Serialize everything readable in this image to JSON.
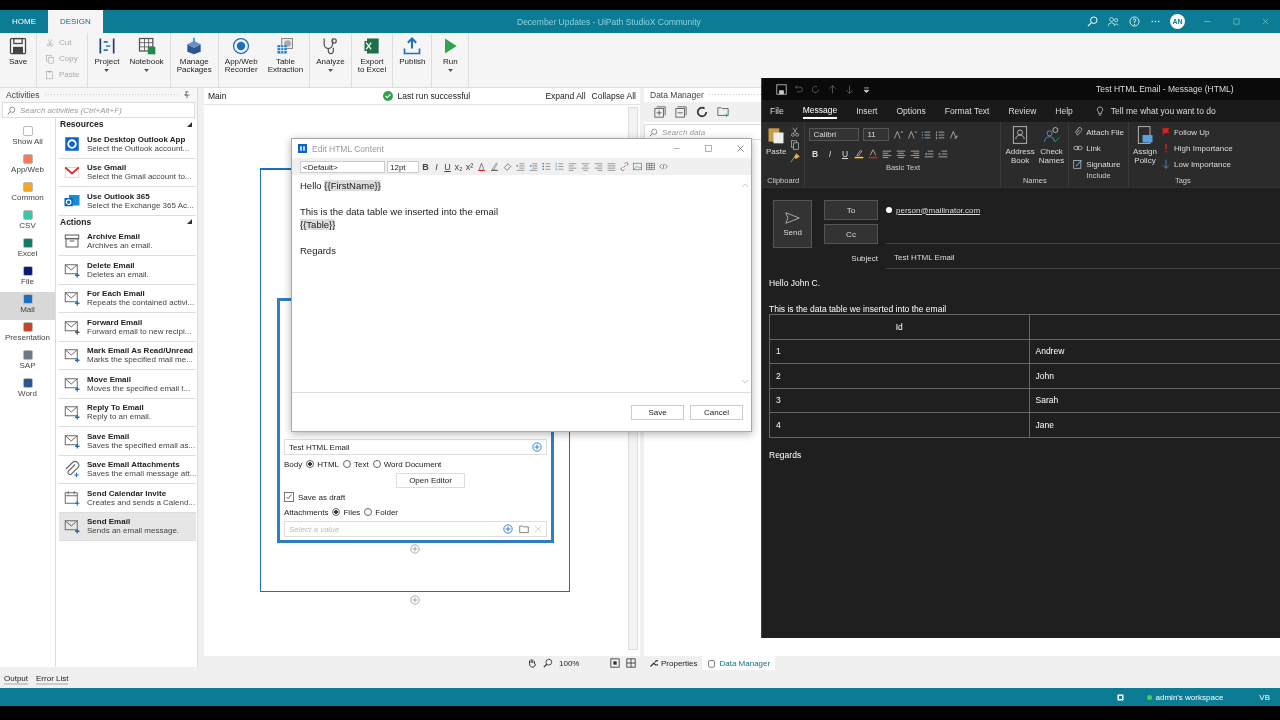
{
  "app": {
    "title": "December Updates - UiPath StudioX Community",
    "user_initials": "AN",
    "tabs": [
      {
        "label": "HOME",
        "selected": false
      },
      {
        "label": "DESIGN",
        "selected": true
      }
    ]
  },
  "ribbon_groups": [
    [
      {
        "kind": "large",
        "label": "Save",
        "menu": false
      }
    ],
    [
      {
        "kind": "small",
        "label": "Cut",
        "disabled": true
      },
      {
        "kind": "small",
        "label": "Copy",
        "disabled": true
      },
      {
        "kind": "small",
        "label": "Paste",
        "disabled": true
      }
    ],
    [
      {
        "kind": "large",
        "label": "Project",
        "menu": true
      },
      {
        "kind": "large",
        "label": "Notebook",
        "menu": true
      }
    ],
    [
      {
        "kind": "large",
        "label": "Manage\nPackages",
        "menu": false
      }
    ],
    [
      {
        "kind": "large",
        "label": "App/Web\nRecorder",
        "menu": false
      },
      {
        "kind": "large",
        "label": "Table\nExtraction",
        "menu": false
      }
    ],
    [
      {
        "kind": "large",
        "label": "Analyze",
        "menu": true
      }
    ],
    [
      {
        "kind": "large",
        "label": "Export\nto Excel",
        "menu": false
      }
    ],
    [
      {
        "kind": "large",
        "label": "Publish",
        "menu": false
      }
    ],
    [
      {
        "kind": "large",
        "label": "Run",
        "menu": true
      }
    ]
  ],
  "activities": {
    "title": "Activities",
    "search_placeholder": "Search activities (Ctrl+Alt+F)",
    "categories": [
      {
        "label": "Show All",
        "color": "#ffffff",
        "selected": false
      },
      {
        "label": "App/Web",
        "color": "#f47c5a",
        "selected": false
      },
      {
        "label": "Common",
        "color": "#f5a623",
        "selected": false
      },
      {
        "label": "CSV",
        "color": "#3cc6a4",
        "selected": false
      },
      {
        "label": "Excel",
        "color": "#127a66",
        "selected": false
      },
      {
        "label": "File",
        "color": "#0b1a7a",
        "selected": false
      },
      {
        "label": "Mail",
        "color": "#1a6fc2",
        "selected": true
      },
      {
        "label": "Presentation",
        "color": "#c4432a",
        "selected": false
      },
      {
        "label": "SAP",
        "color": "#707880",
        "selected": false
      },
      {
        "label": "Word",
        "color": "#2a5597",
        "selected": false
      }
    ],
    "sections": [
      {
        "title": "Resources",
        "items": [
          {
            "title": "Use Desktop Outlook App",
            "desc": "Select the Outlook account...",
            "selected": false
          },
          {
            "title": "Use Gmail",
            "desc": "Select the Gmail account to...",
            "selected": false
          },
          {
            "title": "Use Outlook 365",
            "desc": "Select the Exchange 365 Ac...",
            "selected": false
          }
        ]
      },
      {
        "title": "Actions",
        "items": [
          {
            "title": "Archive Email",
            "desc": "Archives an email.",
            "selected": false
          },
          {
            "title": "Delete Email",
            "desc": "Deletes an email.",
            "selected": false
          },
          {
            "title": "For Each Email",
            "desc": "Repeats the contained activi...",
            "selected": false
          },
          {
            "title": "Forward Email",
            "desc": "Forward email to new recipi...",
            "selected": false
          },
          {
            "title": "Mark Email As Read/Unread",
            "desc": "Marks the specified mail me...",
            "selected": false
          },
          {
            "title": "Move Email",
            "desc": "Moves the specified email t...",
            "selected": false
          },
          {
            "title": "Reply To Email",
            "desc": "Reply to an email.",
            "selected": false
          },
          {
            "title": "Save Email",
            "desc": "Saves the specified email as...",
            "selected": false
          },
          {
            "title": "Save Email Attachments",
            "desc": "Saves the email message att...",
            "selected": false
          },
          {
            "title": "Send Calendar Invite",
            "desc": "Creates and sends a Calend...",
            "selected": false
          },
          {
            "title": "Send Email",
            "desc": "Sends an email message.",
            "selected": true
          }
        ]
      }
    ]
  },
  "designer": {
    "breadcrumb": "Main",
    "run_status": "Last run successful",
    "expand": "Expand All",
    "collapse": "Collapse All",
    "card": {
      "subject_value": "Test HTML Email",
      "body_label": "Body",
      "body_options": [
        {
          "label": "HTML",
          "selected": true
        },
        {
          "label": "Text",
          "selected": false
        },
        {
          "label": "Word Document",
          "selected": false
        }
      ],
      "open_editor": "Open Editor",
      "save_as_draft": {
        "label": "Save as draft",
        "checked": true
      },
      "attachments_label": "Attachments",
      "attachment_options": [
        {
          "label": "Files",
          "selected": true
        },
        {
          "label": "Folder",
          "selected": false
        }
      ],
      "attachment_placeholder": "Select a value"
    },
    "zoom": "100%"
  },
  "data_manager": {
    "title": "Data Manager",
    "search_placeholder": "Search data"
  },
  "panel_tabs": [
    {
      "label": "Properties",
      "selected": false
    },
    {
      "label": "Data Manager",
      "selected": true
    }
  ],
  "output_tabs": [
    "Output",
    "Error List"
  ],
  "status_bar": {
    "workspace": "admin's workspace",
    "language": "VB"
  },
  "editor_dialog": {
    "title": "Edit HTML Content",
    "font": "<Default>",
    "size": "12pt",
    "format_buttons": [
      "B",
      "I",
      "U",
      "x₂",
      "x²"
    ],
    "paragraphs": [
      [
        {
          "text": "Hello ",
          "kind": "plain"
        },
        {
          "text": "{{FirstName}}",
          "kind": "token"
        }
      ],
      [
        {
          "text": "This is the data table we inserted into the email",
          "kind": "plain"
        }
      ],
      [
        {
          "text": "{{Table}}",
          "kind": "token"
        }
      ],
      [
        {
          "text": "Regards",
          "kind": "plain"
        }
      ]
    ],
    "buttons": [
      "Save",
      "Cancel"
    ]
  },
  "outlook": {
    "title": "Test HTML Email  -  Message (HTML)",
    "tabs": [
      {
        "label": "File",
        "selected": false
      },
      {
        "label": "Message",
        "selected": true
      },
      {
        "label": "Insert",
        "selected": false
      },
      {
        "label": "Options",
        "selected": false
      },
      {
        "label": "Format Text",
        "selected": false
      },
      {
        "label": "Review",
        "selected": false
      },
      {
        "label": "Help",
        "selected": false
      }
    ],
    "tell_me": "Tell me what you want to do",
    "paste": "Paste",
    "font": "Calibri",
    "size": "11",
    "format_buttons": [
      "B",
      "I",
      "U"
    ],
    "address_book": "Address\nBook",
    "check_names": "Check\nNames",
    "attach_file": "Attach File",
    "link": "Link",
    "signature": "Signature",
    "assign_policy": "Assign\nPolicy",
    "follow_up": "Follow Up",
    "high_importance": "High Importance",
    "low_importance": "Low Importance",
    "group_labels": [
      "Clipboard",
      "Basic Text",
      "Names",
      "Include",
      "Tags"
    ],
    "send": "Send",
    "to": "To",
    "cc": "Cc",
    "to_value": "person@mailinator.com",
    "subject_label": "Subject",
    "subject_value": "Test HTML Email",
    "greeting": "Hello John C.",
    "intro": "This is the data table we inserted into the email",
    "table": {
      "columns": [
        "Id"
      ],
      "rows": [
        [
          "1",
          "Andrew"
        ],
        [
          "2",
          "John"
        ],
        [
          "3",
          "Sarah"
        ],
        [
          "4",
          "Jane"
        ]
      ]
    },
    "closing": "Regards"
  }
}
